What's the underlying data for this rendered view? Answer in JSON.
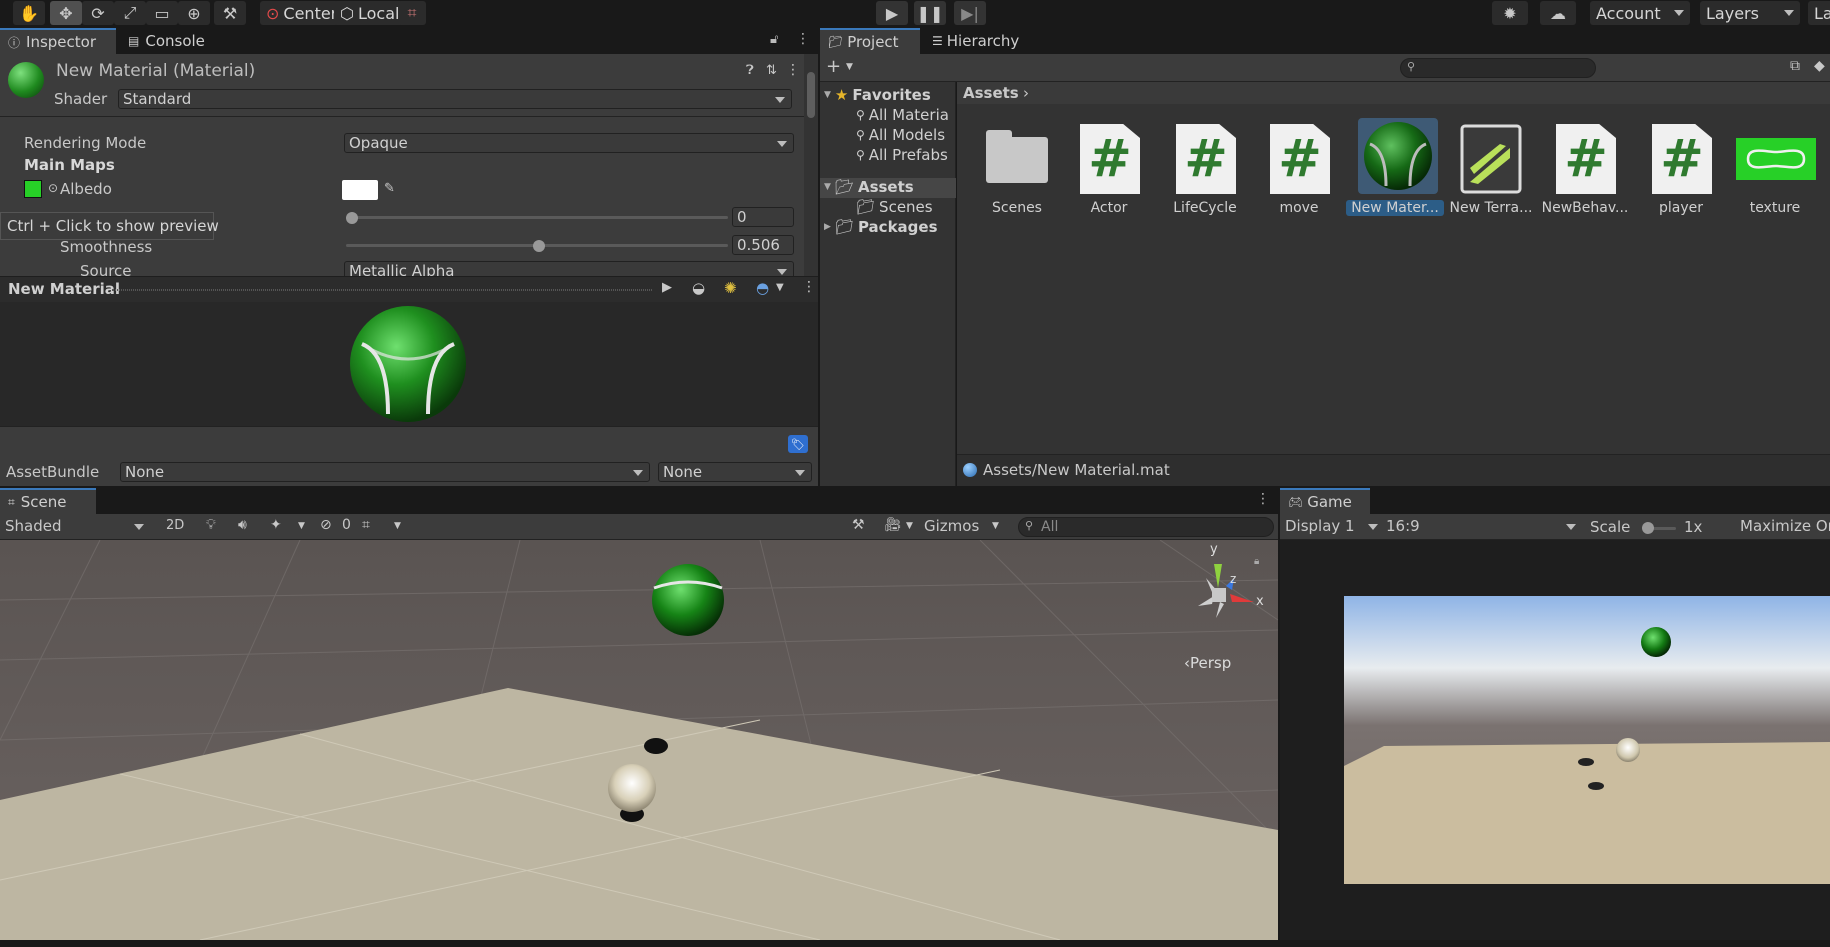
{
  "toolbar": {
    "pivot_center": "Center",
    "pivot_local": "Local",
    "account": "Account",
    "layers": "Layers",
    "layout_partial": "La"
  },
  "inspector": {
    "tab_inspector": "Inspector",
    "tab_console": "Console",
    "material_title": "New Material (Material)",
    "shader_label": "Shader",
    "shader_value": "Standard",
    "rendering_mode_label": "Rendering Mode",
    "rendering_mode_value": "Opaque",
    "main_maps": "Main Maps",
    "albedo": "Albedo",
    "metallic_value": "0",
    "tooltip": "Ctrl + Click to show preview",
    "smoothness": "Smoothness",
    "smoothness_value": "0.506",
    "source_label": "Source",
    "source_value": "Metallic Alpha",
    "metallic_fraction": 0.0,
    "smoothness_fraction": 0.506,
    "preview_title": "New Material",
    "assetbundle_label": "AssetBundle",
    "assetbundle_value": "None",
    "assetbundle_variant": "None"
  },
  "project": {
    "tab_project": "Project",
    "tab_hierarchy": "Hierarchy",
    "favorites": "Favorites",
    "fav_items": [
      "All Materia",
      "All Models",
      "All Prefabs"
    ],
    "assets": "Assets",
    "scenes": "Scenes",
    "packages": "Packages",
    "breadcrumb": "Assets",
    "items": [
      "Scenes",
      "Actor",
      "LifeCycle",
      "move",
      "New Mater...",
      "New Terra...",
      "NewBehav...",
      "player",
      "texture"
    ],
    "status_path": "Assets/New Material.mat"
  },
  "scene": {
    "tab": "Scene",
    "shading": "Shaded",
    "mode_2d": "2D",
    "hidden_count": "0",
    "gizmos": "Gizmos",
    "search_placeholder": "All",
    "axis_y": "y",
    "axis_x": "x",
    "axis_z": "z",
    "persp": "Persp"
  },
  "game": {
    "tab": "Game",
    "display": "Display 1",
    "aspect": "16:9",
    "scale_label": "Scale",
    "scale_value": "1x",
    "maximize": "Maximize Or"
  },
  "colors": {
    "accent": "#3a79bb",
    "selection": "#2c5d87",
    "material_green": "#1f8a1f"
  }
}
